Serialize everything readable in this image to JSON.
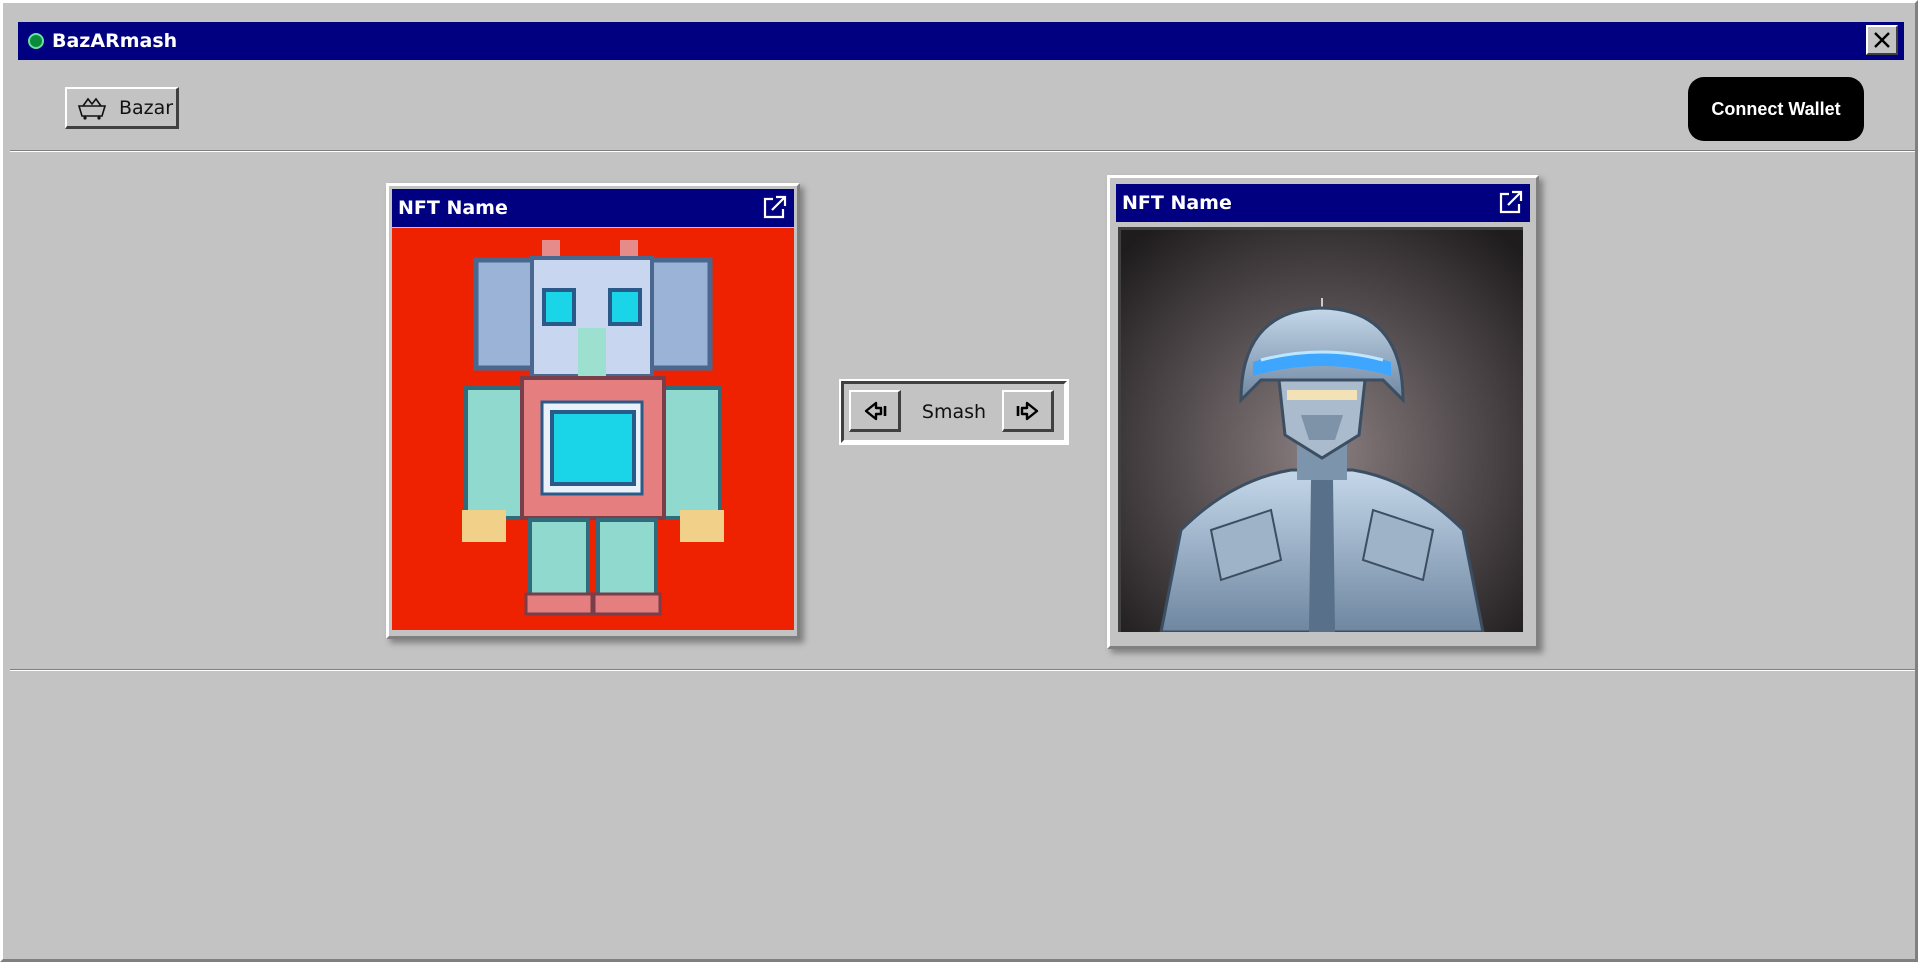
{
  "window": {
    "title": "BazARmash"
  },
  "toolbar": {
    "bazar_label": "Bazar",
    "connect_label": "Connect Wallet"
  },
  "cards": [
    {
      "title": "NFT Name",
      "image": "pixel-art elephant robot on red background"
    },
    {
      "title": "NFT Name",
      "image": "armored cyborg soldier with glowing blue helmet"
    }
  ],
  "smash": {
    "label": "Smash"
  },
  "colors": {
    "titlebar": "#000080",
    "background": "#c3c3c3",
    "card1_bg": "#ee2200",
    "connect_bg": "#000000"
  }
}
